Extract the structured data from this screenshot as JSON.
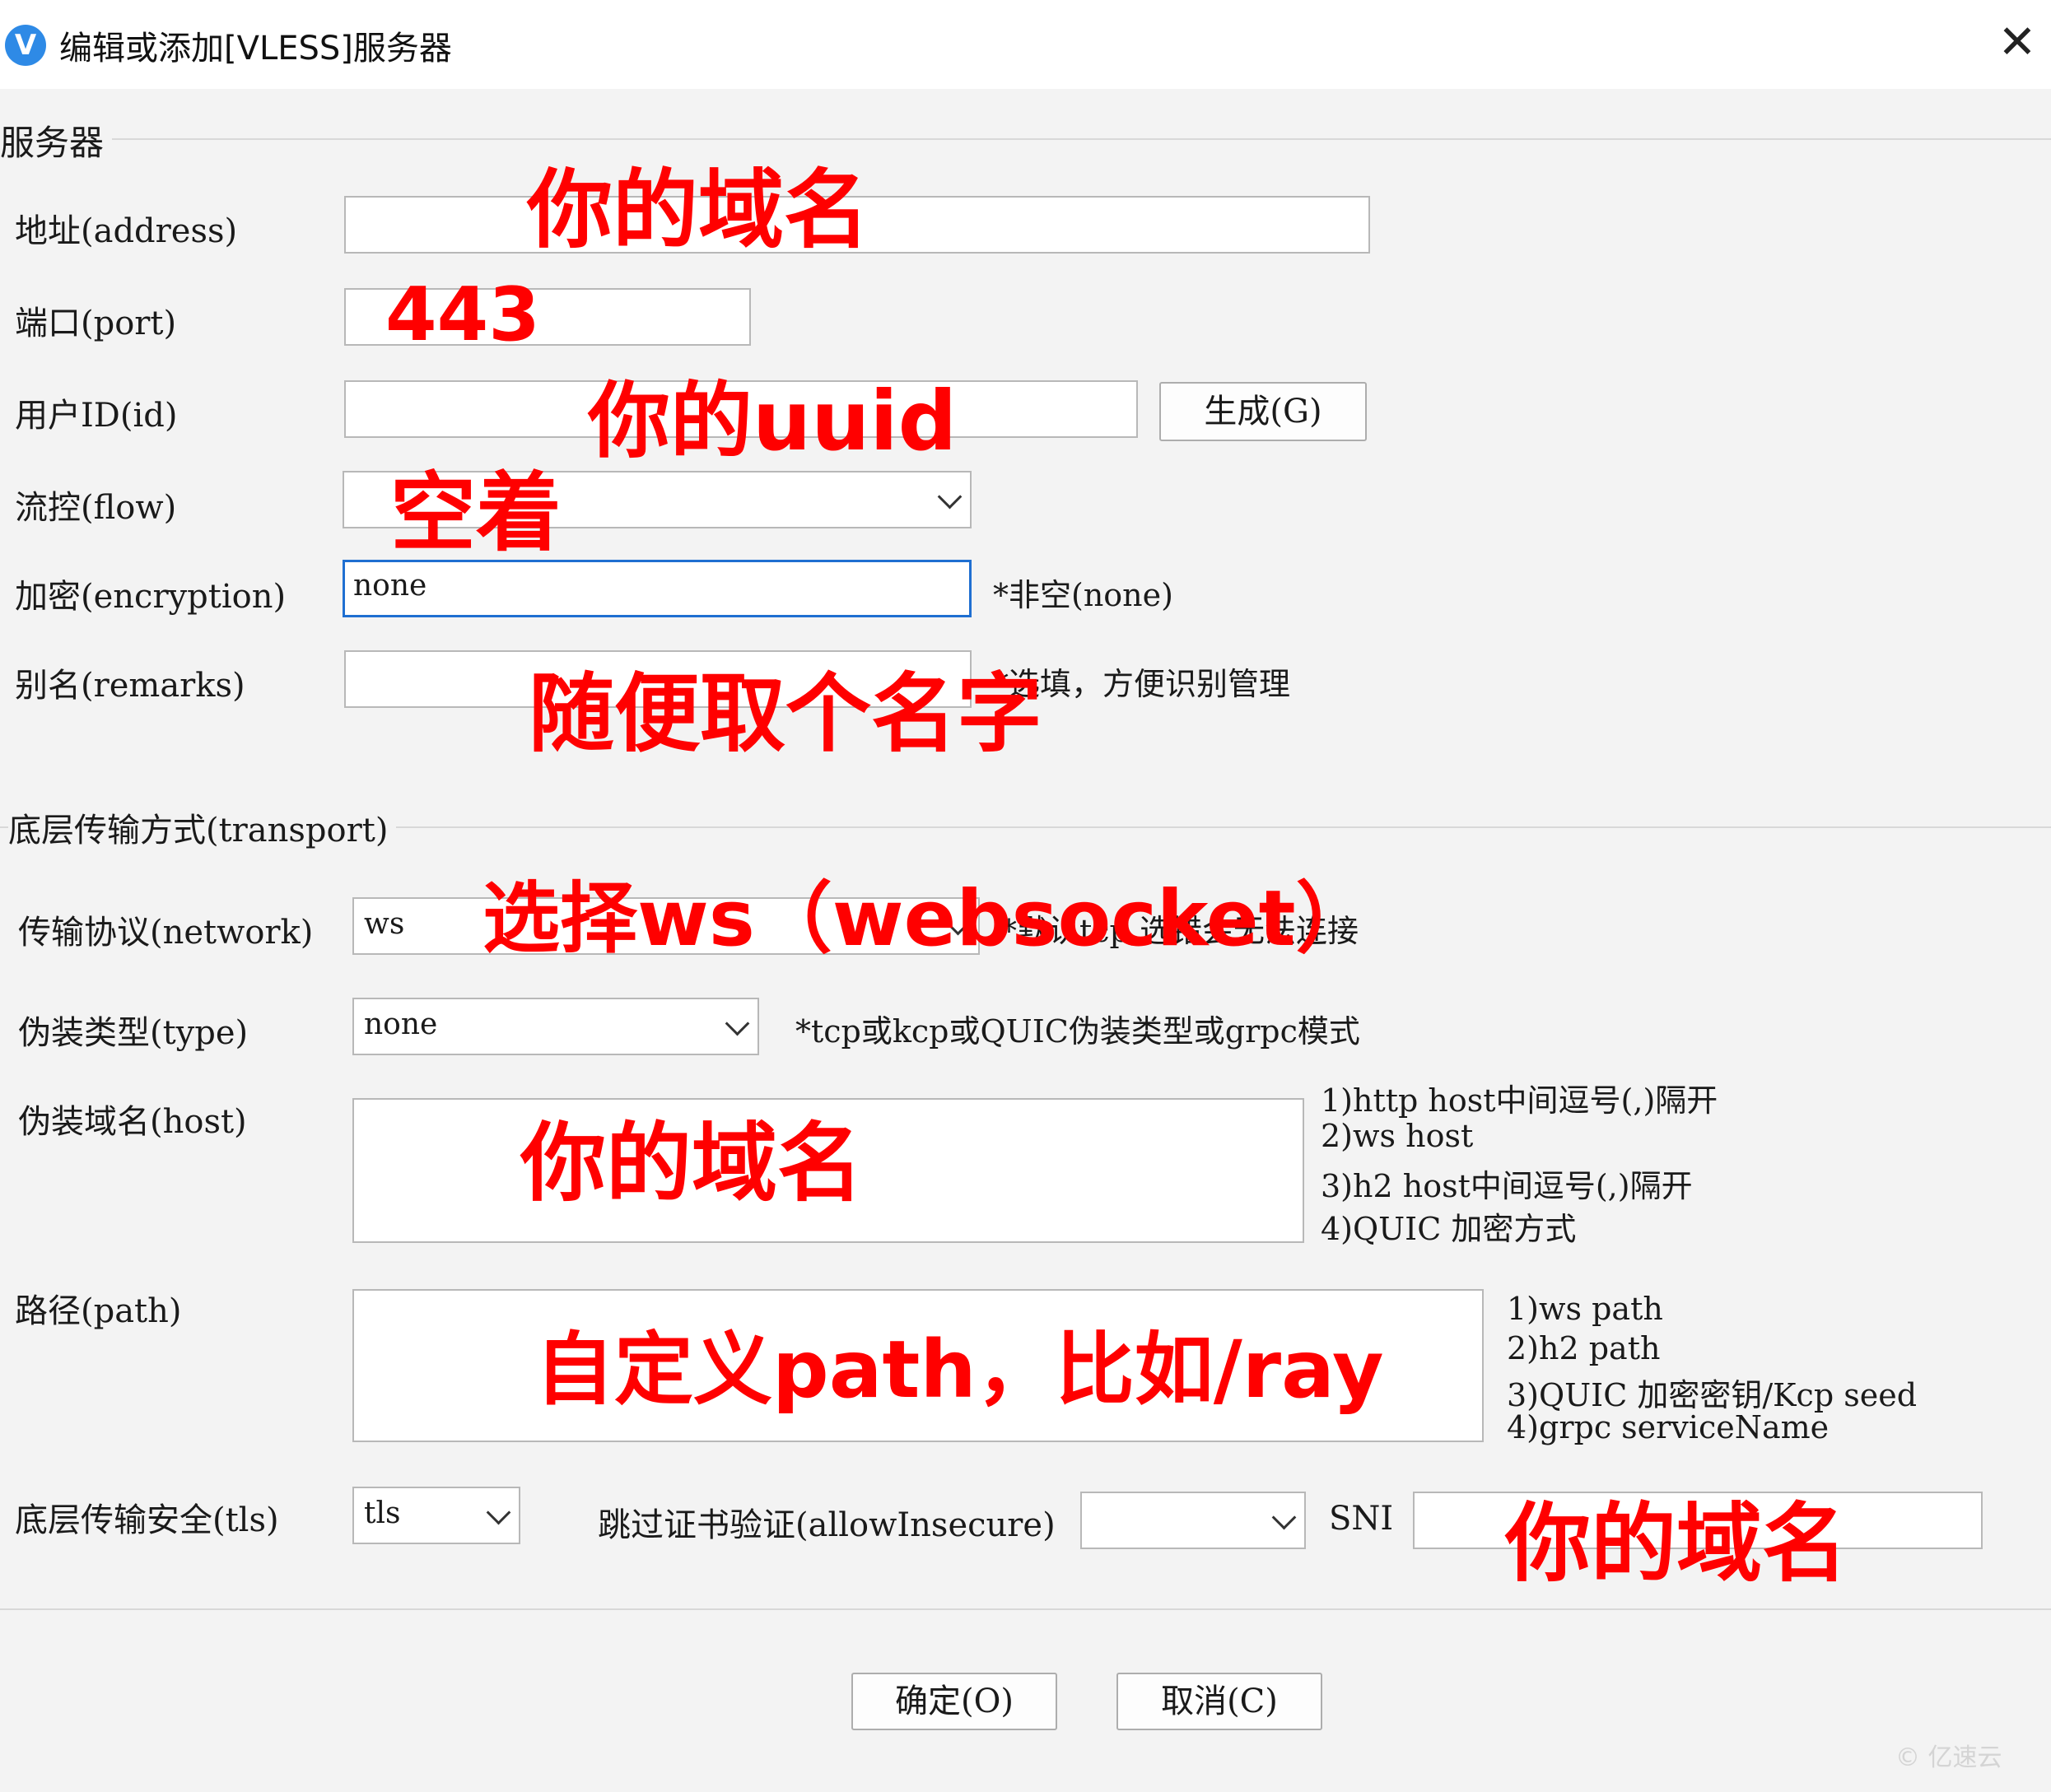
{
  "window": {
    "title": "编辑或添加[VLESS]服务器",
    "close_glyph": "✕",
    "app_icon_glyph": "V"
  },
  "server_group": {
    "title": "服务器",
    "address_label": "地址(address)",
    "address_value": "",
    "port_label": "端口(port)",
    "port_value": "",
    "id_label": "用户ID(id)",
    "id_value": "",
    "generate_button": "生成(G)",
    "flow_label": "流控(flow)",
    "flow_value": "",
    "encryption_label": "加密(encryption)",
    "encryption_value": "none",
    "encryption_hint": "*非空(none)",
    "remarks_label": "别名(remarks)",
    "remarks_value": "",
    "remarks_hint": "*选填，方便识别管理"
  },
  "transport_group": {
    "title": "底层传输方式(transport)",
    "network_label": "传输协议(network)",
    "network_value": "ws",
    "network_hint": "*默认tcp,选错会无法连接",
    "type_label": "伪装类型(type)",
    "type_value": "none",
    "type_hint": "*tcp或kcp或QUIC伪装类型或grpc模式",
    "host_label": "伪装域名(host)",
    "host_value": "",
    "host_hints": [
      "1)http host中间逗号(,)隔开",
      "2)ws host",
      "3)h2 host中间逗号(,)隔开",
      "4)QUIC 加密方式"
    ],
    "path_label": "路径(path)",
    "path_value": "",
    "path_hints": [
      "1)ws path",
      "2)h2 path",
      "3)QUIC 加密密钥/Kcp seed",
      "4)grpc serviceName"
    ],
    "tls_label": "底层传输安全(tls)",
    "tls_value": "tls",
    "allow_insecure_label": "跳过证书验证(allowInsecure)",
    "allow_insecure_value": "",
    "sni_label": "SNI",
    "sni_value": ""
  },
  "footer": {
    "ok_button": "确定(O)",
    "cancel_button": "取消(C)"
  },
  "annotations": {
    "address": "你的域名",
    "port": "443",
    "uuid": "你的uuid",
    "flow": "空着",
    "remarks": "随便取个名字",
    "network": "选择ws（websocket）",
    "host": "你的域名",
    "path": "自定义path，比如/ray",
    "sni": "你的域名",
    "color": "#ff0000"
  },
  "watermark": "© 亿速云"
}
